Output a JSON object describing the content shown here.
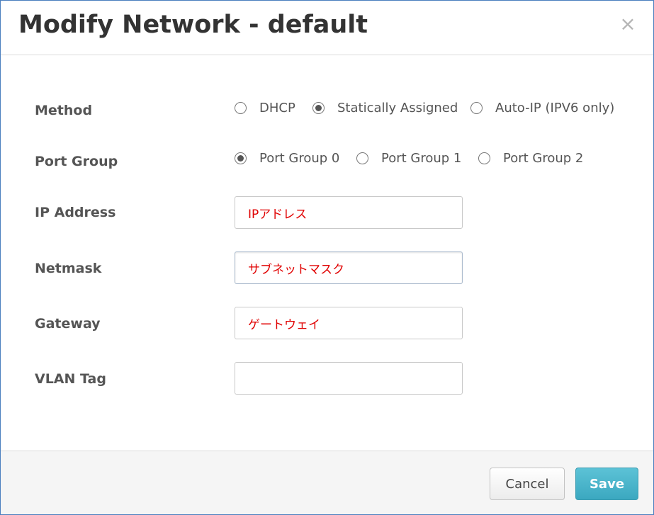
{
  "dialog": {
    "title": "Modify Network - default",
    "close_icon": "×"
  },
  "form": {
    "method": {
      "label": "Method",
      "options": [
        "DHCP",
        "Statically Assigned",
        "Auto-IP (IPV6 only)"
      ],
      "selected": "Statically Assigned"
    },
    "port_group": {
      "label": "Port Group",
      "options": [
        "Port Group 0",
        "Port Group 1",
        "Port Group 2"
      ],
      "selected": "Port Group 0"
    },
    "ip_address": {
      "label": "IP Address",
      "value": "IPアドレス"
    },
    "netmask": {
      "label": "Netmask",
      "value": "サブネットマスク"
    },
    "gateway": {
      "label": "Gateway",
      "value": "ゲートウェイ"
    },
    "vlan_tag": {
      "label": "VLAN Tag",
      "value": ""
    }
  },
  "footer": {
    "cancel_label": "Cancel",
    "save_label": "Save"
  },
  "colors": {
    "input_text": "#e00000",
    "save_button": "#44b3c8",
    "border_accent": "#4a7fbf"
  }
}
